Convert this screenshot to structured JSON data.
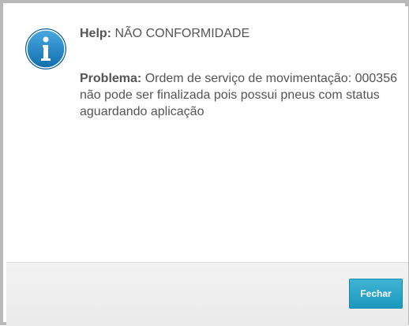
{
  "dialog": {
    "icon": "info-icon",
    "accent_color": "#1c87c4",
    "help_label": "Help:",
    "help_text": "NÃO CONFORMIDADE",
    "problem_label": "Problema:",
    "problem_text": "Ordem de serviço de movimentação: 000356 não pode ser finalizada pois possui pneus com status aguardando aplicação"
  },
  "footer": {
    "close_button_label": "Fechar",
    "button_color": "#2aa5cb"
  }
}
